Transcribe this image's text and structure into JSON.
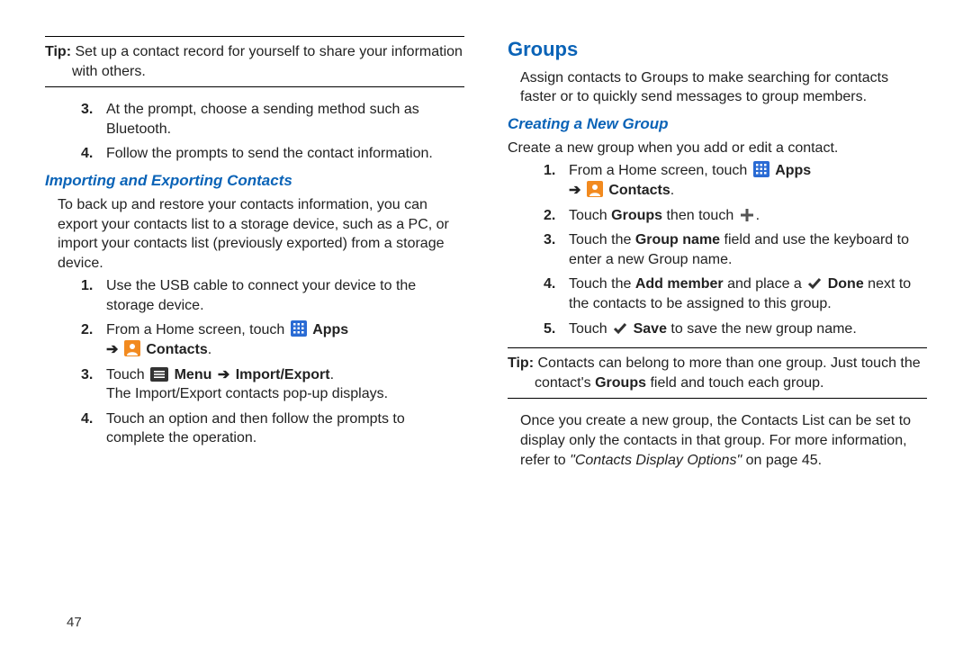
{
  "page_number": "47",
  "left": {
    "tip": {
      "label": "Tip:",
      "text": "Set up a contact record for yourself to share your information with others."
    },
    "steps_cont": {
      "item3": "At the prompt, choose a sending method such as Bluetooth.",
      "item4": "Follow the prompts to send the contact information."
    },
    "h2": "Importing and Exporting Contacts",
    "intro": "To back up and restore your contacts information, you can export your contacts list to a storage device, such as a PC, or import your contacts list (previously exported) from a storage device.",
    "steps": {
      "s1": "Use the USB cable to connect your device to the storage device.",
      "s2a": "From a Home screen, touch ",
      "s2_apps": "Apps",
      "s2_arrow": "➔",
      "s2_contacts": "Contacts",
      "s3a": "Touch ",
      "s3_menu": "Menu",
      "s3_arrow": "➔",
      "s3_ie": "Import/Export",
      "s3b": "The Import/Export contacts pop-up displays.",
      "s4": "Touch an option and then follow the prompts to complete the operation."
    }
  },
  "right": {
    "h1": "Groups",
    "intro": "Assign contacts to Groups to make searching for contacts faster or to quickly send messages to group members.",
    "h2": "Creating a New Group",
    "intro2": "Create a new group when you add or edit a contact.",
    "steps": {
      "s1a": "From a Home screen, touch ",
      "s1_apps": "Apps",
      "s1_arrow": "➔",
      "s1_contacts": "Contacts",
      "s2a": "Touch ",
      "s2_groups": "Groups",
      "s2b": " then touch ",
      "s3a": "Touch the ",
      "s3_gn": "Group name",
      "s3b": " field and use the keyboard to enter a new Group name.",
      "s4a": "Touch the ",
      "s4_am": "Add member",
      "s4b": " and place a ",
      "s4_done": "Done",
      "s4c": " next to the contacts to be assigned to this group.",
      "s5a": "Touch ",
      "s5_save": "Save",
      "s5b": " to save the new group name."
    },
    "tip": {
      "label": "Tip:",
      "text_a": "Contacts can belong to more than one group. Just touch the contact's ",
      "text_groups": "Groups",
      "text_b": " field and touch each group."
    },
    "after_a": "Once you create a new group, the Contacts List can be set to display only the contacts in that group. For more information, refer to ",
    "after_ref": "\"Contacts Display Options\"",
    "after_b": " on page 45."
  }
}
